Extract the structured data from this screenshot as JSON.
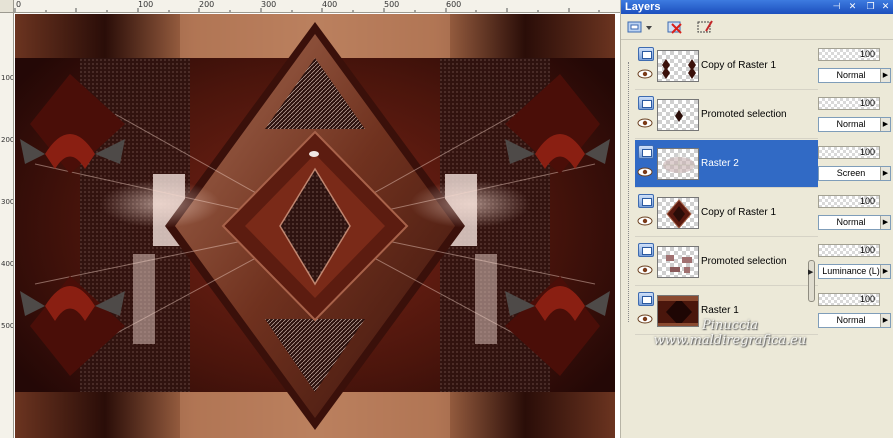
{
  "ruler": {
    "horizontal_labels": [
      "0",
      "100",
      "200",
      "300",
      "400",
      "500",
      "600"
    ],
    "vertical_labels": [
      "100",
      "200",
      "300",
      "400",
      "500"
    ]
  },
  "palette": {
    "title": "Layers",
    "title_buttons": [
      "pin-icon",
      "close-icon",
      "restore-icon",
      "close-window-icon"
    ]
  },
  "toolbar": {
    "tools": [
      "new-raster-layer-icon",
      "delete-layer-icon",
      "edit-selection-icon"
    ]
  },
  "layers": [
    {
      "name": "Copy of Raster 1",
      "opacity": "100",
      "blend": "Normal",
      "selected": false
    },
    {
      "name": "Promoted selection",
      "opacity": "100",
      "blend": "Normal",
      "selected": false
    },
    {
      "name": "Raster 2",
      "opacity": "100",
      "blend": "Screen",
      "selected": true
    },
    {
      "name": "Copy of Raster 1",
      "opacity": "100",
      "blend": "Normal",
      "selected": false
    },
    {
      "name": "Promoted selection",
      "opacity": "100",
      "blend": "Luminance (L)",
      "selected": false
    },
    {
      "name": "Raster 1",
      "opacity": "100",
      "blend": "Normal",
      "selected": false
    }
  ],
  "watermark": {
    "line1": "Pinuccia",
    "line2": "www.maldiregrafica.eu"
  },
  "colors": {
    "selection": "#316ac5",
    "title_bar": "#2a63d0",
    "panel_bg": "#ece9d8"
  }
}
